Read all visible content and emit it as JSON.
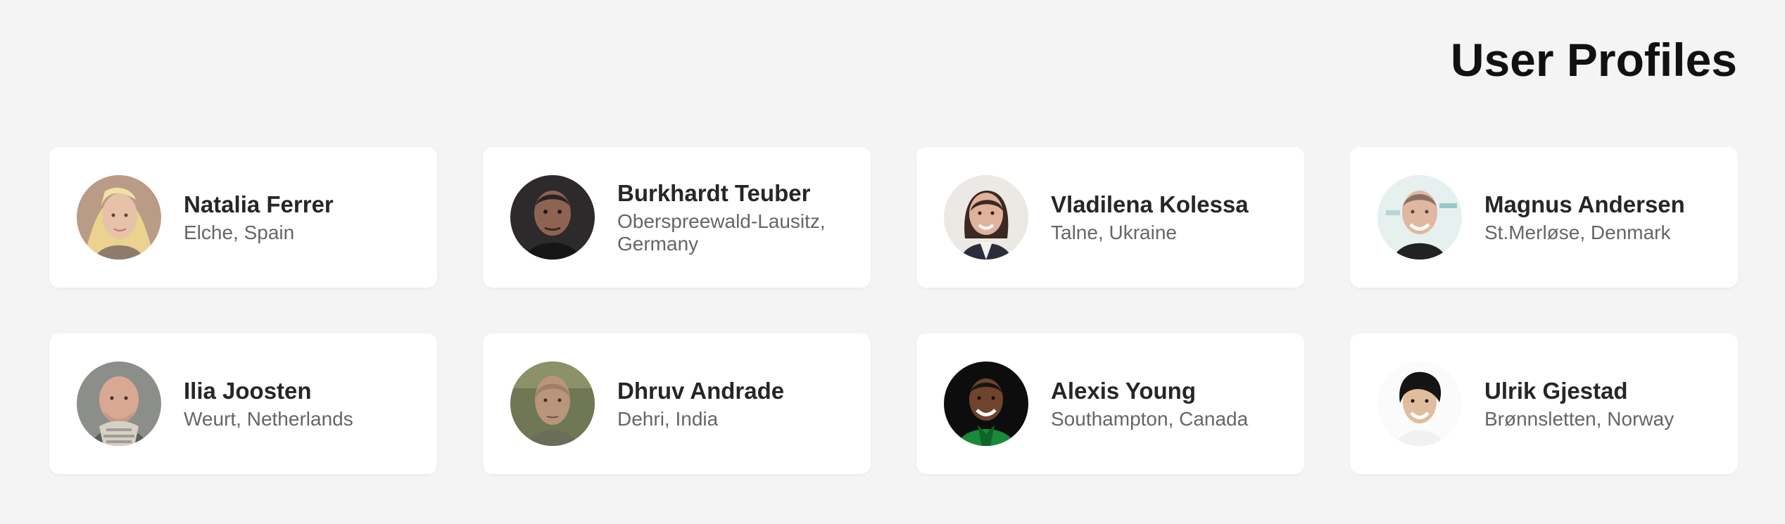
{
  "header": {
    "title": "User Profiles"
  },
  "profiles": [
    {
      "name": "Natalia Ferrer",
      "location": "Elche, Spain",
      "avatar": "woman-blonde-avatar",
      "colors": {
        "bg": "#b99b86",
        "skin": "#e6c2a8",
        "hair": "#e9d38f",
        "shirt": "#8e7b6c"
      }
    },
    {
      "name": "Burkhardt Teuber",
      "location": "Oberspreewald-Lausitz, Germany",
      "avatar": "man-dark-background-avatar",
      "colors": {
        "bg": "#2c2a2b",
        "skin": "#8f6353",
        "hair": "#282425",
        "shirt": "#171617"
      }
    },
    {
      "name": "Vladilena Kolessa",
      "location": "Talne, Ukraine",
      "avatar": "woman-dark-hair-avatar",
      "colors": {
        "bg": "#ece9e4",
        "skin": "#e0b29b",
        "hair": "#3a2823",
        "shirt": "#2b2e3a"
      }
    },
    {
      "name": "Magnus Andersen",
      "location": "St.Merløse, Denmark",
      "avatar": "man-smiling-avatar",
      "colors": {
        "bg": "#e6f0ef",
        "skin": "#e0b7a0",
        "hair": "#8a7060",
        "shirt": "#222222"
      }
    },
    {
      "name": "Ilia Joosten",
      "location": "Weurt, Netherlands",
      "avatar": "man-bald-scarf-avatar",
      "colors": {
        "bg": "#8b8e89",
        "skin": "#d9a892",
        "hair": "#c39a88",
        "shirt": "#5c5f58"
      }
    },
    {
      "name": "Dhruv Andrade",
      "location": "Dehri, India",
      "avatar": "man-shaved-head-avatar",
      "colors": {
        "bg": "#6f7754",
        "skin": "#b8957b",
        "hair": "#9f7f6a",
        "shirt": "#6a6d5a"
      }
    },
    {
      "name": "Alexis Young",
      "location": "Southampton, Canada",
      "avatar": "man-green-shirt-avatar",
      "colors": {
        "bg": "#0d0d0d",
        "skin": "#6f432d",
        "hair": "#151515",
        "shirt": "#198a37"
      }
    },
    {
      "name": "Ulrik Gjestad",
      "location": "Brønnsletten, Norway",
      "avatar": "man-black-hair-avatar",
      "colors": {
        "bg": "#fbfbfb",
        "skin": "#dfbd9d",
        "hair": "#141414",
        "shirt": "#f1f1f1"
      }
    }
  ]
}
